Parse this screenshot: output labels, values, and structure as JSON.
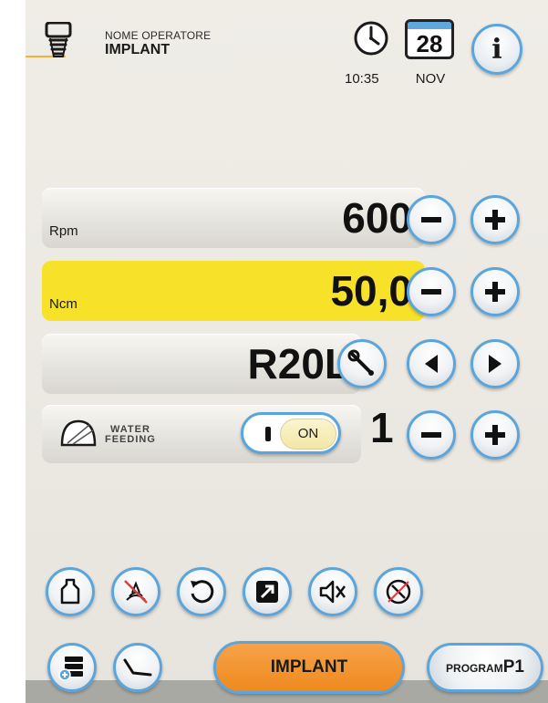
{
  "header": {
    "operator_label": "NOME OPERATORE",
    "operator_name": "IMPLANT",
    "time": "10:35",
    "day": "28",
    "month": "NOV"
  },
  "rpm": {
    "label": "Rpm",
    "value": "600"
  },
  "torque": {
    "label": "Ncm",
    "value": "50,0"
  },
  "ratio": {
    "value": "R20L"
  },
  "water": {
    "label_line1": "WATER",
    "label_line2": "FEEDING",
    "toggle": "ON",
    "level": "1"
  },
  "bottom": {
    "mode_button": "IMPLANT",
    "program_prefix": "PROGRAM",
    "program_value": "P1"
  },
  "colors": {
    "accent_blue": "#5ba5dc",
    "highlight_yellow": "#f7e129",
    "active_orange": "#ef8a1e",
    "warning_red": "#e23b3b"
  },
  "icons": {
    "header": [
      "implant-tooth-icon",
      "clock-icon",
      "calendar-icon",
      "info-icon"
    ],
    "tools": [
      "bottle-icon",
      "light-off-icon",
      "reverse-rotation-icon",
      "expand-icon",
      "mute-icon",
      "disabled-icon"
    ],
    "nav": [
      "program-list-icon",
      "handpiece-icon"
    ]
  }
}
